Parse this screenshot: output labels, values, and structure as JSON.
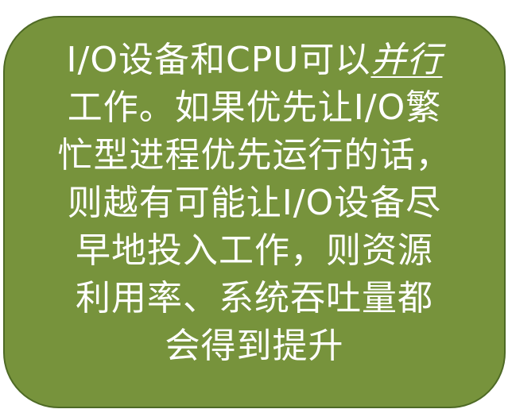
{
  "slide": {
    "line1_prefix": "I/O设备和CPU可以",
    "line1_emphasis": "并行",
    "line2": "工作。如果优先让I/O繁",
    "line3": "忙型进程优先运行的话，",
    "line4": "则越有可能让I/O设备尽",
    "line5": "早地投入工作，则资源",
    "line6": "利用率、系统吞吐量都",
    "line7": "会得到提升"
  },
  "colors": {
    "callout_fill": "#77933c",
    "callout_border": "#4e6a25",
    "text": "#ffffff"
  }
}
